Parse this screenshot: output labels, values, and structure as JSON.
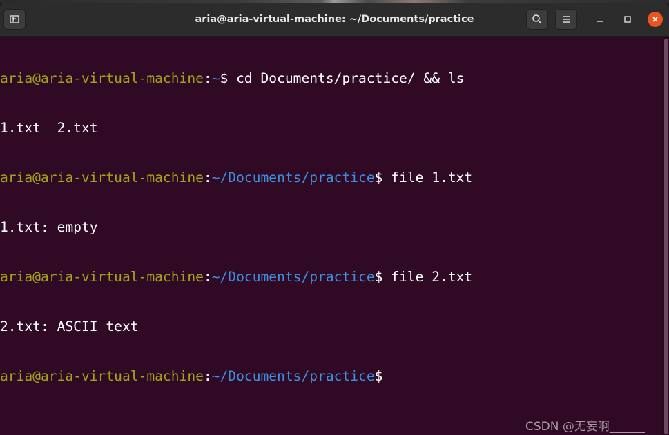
{
  "window": {
    "title": "aria@aria-virtual-machine: ~/Documents/practice"
  },
  "terminal": {
    "lines": [
      {
        "user": "aria@aria-virtual-machine",
        "sep": ":",
        "path": "~",
        "sym": "$",
        "cmd": " cd Documents/practice/ && ls"
      },
      {
        "output": "1.txt  2.txt"
      },
      {
        "user": "aria@aria-virtual-machine",
        "sep": ":",
        "path": "~/Documents/practice",
        "sym": "$",
        "cmd": " file 1.txt"
      },
      {
        "output": "1.txt: empty"
      },
      {
        "user": "aria@aria-virtual-machine",
        "sep": ":",
        "path": "~/Documents/practice",
        "sym": "$",
        "cmd": " file 2.txt"
      },
      {
        "output": "2.txt: ASCII text"
      },
      {
        "user": "aria@aria-virtual-machine",
        "sep": ":",
        "path": "~/Documents/practice",
        "sym": "$",
        "cmd": ""
      }
    ]
  },
  "watermark": "CSDN @无妄啊______",
  "icons": {
    "new_tab": "new-tab-icon",
    "search": "search-icon",
    "menu": "hamburger-menu-icon",
    "minimize": "minimize-icon",
    "maximize": "maximize-icon",
    "close": "close-icon"
  },
  "colors": {
    "terminal_bg": "#300a24",
    "user_host": "#a3a31a",
    "path": "#3d8fe0",
    "text": "#ffffff",
    "close_button": "#e95420"
  }
}
